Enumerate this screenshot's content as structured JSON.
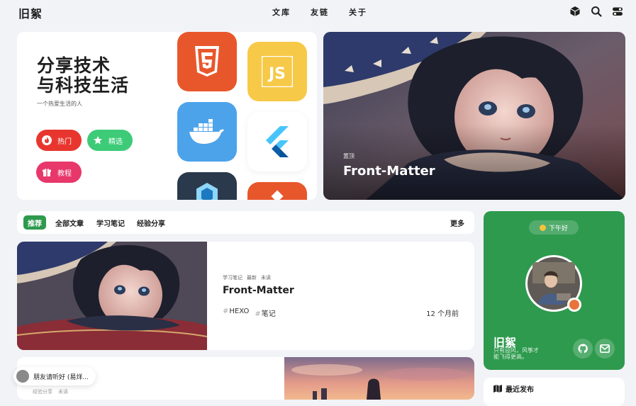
{
  "nav": {
    "logo": "旧絮",
    "menu": [
      "文库",
      "友链",
      "关于"
    ],
    "icons": [
      "cube-icon",
      "search-icon",
      "toggle-icon"
    ]
  },
  "hero": {
    "title": "分享技术\n与科技生活",
    "subtitle": "一个热爱生活的人",
    "buttons": [
      {
        "label": "热门",
        "icon": "fire-icon",
        "color": "#e8362f"
      },
      {
        "label": "精选",
        "icon": "star-icon",
        "color": "#3dcb78"
      },
      {
        "label": "教程",
        "icon": "gift-icon",
        "color": "#e8376a"
      }
    ],
    "tiles": [
      "html5-icon",
      "javascript-icon",
      "docker-icon",
      "flutter-icon",
      "webpack-icon",
      "git-icon"
    ]
  },
  "featured": {
    "pin_label": "置顶",
    "title": "Front-Matter"
  },
  "tabs": {
    "items": [
      "推荐",
      "全部文章",
      "学习笔记",
      "经验分享"
    ],
    "more": "更多",
    "accent": "#2e9a4e"
  },
  "post1": {
    "meta": [
      "学习笔记",
      "最新",
      "未读"
    ],
    "title": "Front-Matter",
    "tags": [
      "HEXO",
      "笔记"
    ],
    "date": "12 个月前"
  },
  "post2": {
    "meta": [
      "经验分享",
      "未读"
    ]
  },
  "toast": {
    "text": "朋友请听好 (易烊..."
  },
  "profile": {
    "greeting": "下午好",
    "name": "旧絮",
    "desc": "只有迎风，风筝才能飞得更高。",
    "color": "#2e9a4e"
  },
  "recent": {
    "title": "最近发布"
  }
}
